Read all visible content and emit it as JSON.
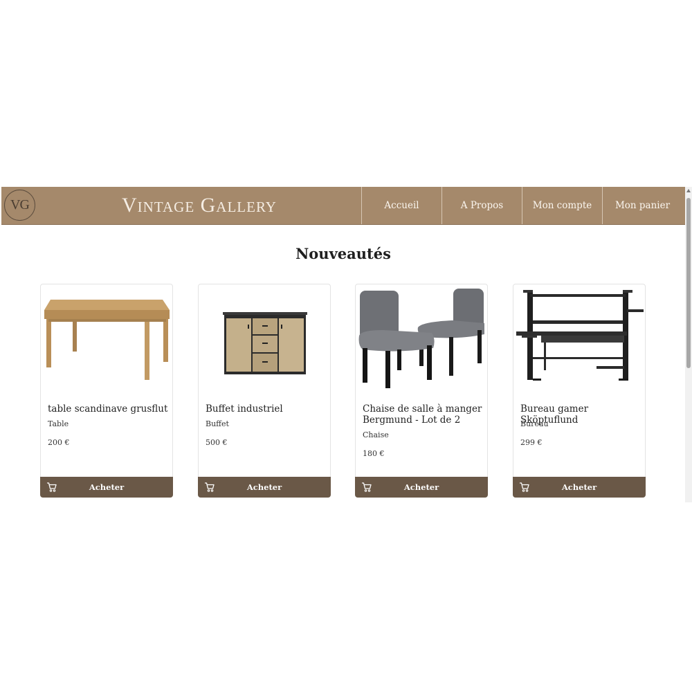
{
  "header": {
    "logo_text": "VG",
    "brand": "Vintage Gallery",
    "nav": [
      "Accueil",
      "A Propos",
      "Mon compte",
      "Mon panier"
    ]
  },
  "main": {
    "title": "Nouveautés",
    "products": [
      {
        "name": "table scandinave grusflut",
        "category": "Table",
        "price": "200 €",
        "button": "Acheter"
      },
      {
        "name": "Buffet industriel",
        "category": "Buffet",
        "price": "500 €",
        "button": "Acheter"
      },
      {
        "name": "Chaise de salle à manger Bergmund - Lot de 2",
        "category": "Chaise",
        "price": "180 €",
        "button": "Acheter"
      },
      {
        "name": "Bureau gamer Sköptuflund",
        "category": "Bureau",
        "price": "299 €",
        "button": "Acheter"
      }
    ]
  },
  "icons": {
    "cart": "cart-icon",
    "logo": "vg-monogram"
  },
  "colors": {
    "header": "#a5896b",
    "button": "#6a5847"
  }
}
